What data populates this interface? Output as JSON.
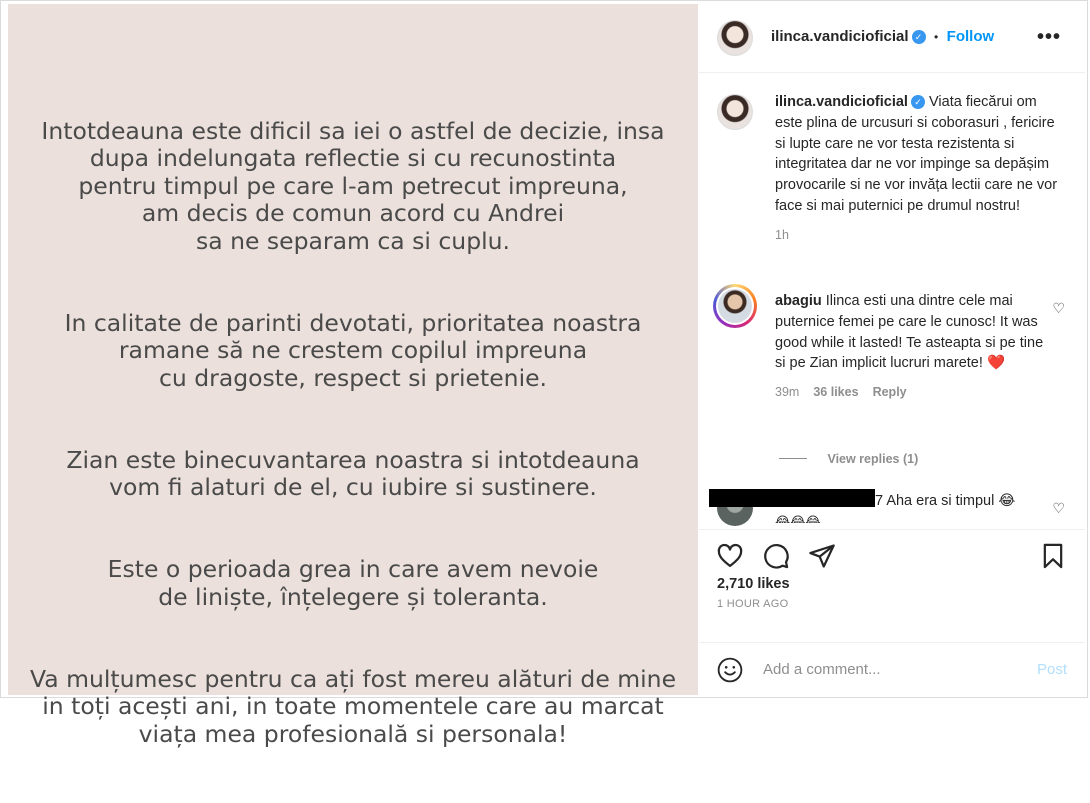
{
  "post": {
    "paragraphs": [
      "Intotdeauna este dificil sa iei o astfel de decizie, insa\ndupa indelungata reflectie si cu recunostinta\npentru timpul pe care l-am petrecut impreuna,\nam decis de comun acord cu Andrei\nsa ne separam ca si cuplu.",
      "In calitate de parinti devotati, prioritatea noastra\nramane să ne crestem copilul impreuna\ncu dragoste, respect si prietenie.",
      "Zian este binecuvantarea noastra si intotdeauna\nvom fi alaturi de el, cu iubire si sustinere.",
      "Este o perioada grea in care avem nevoie\nde liniște, înțelegere și toleranta.",
      "Va mulțumesc pentru ca ați fost mereu alături de mine\nin toți acești ani, in toate momentele care au marcat\nviața mea profesională si personala!"
    ]
  },
  "header": {
    "username": "ilinca.vandicioficial",
    "separator": "•",
    "follow_label": "Follow"
  },
  "caption": {
    "username": "ilinca.vandicioficial",
    "text": "Viata fiecărui om este plina de urcusuri si coborasuri , fericire si lupte care ne vor testa rezistenta si integritatea dar ne vor impinge sa depășim provocarile si ne vor invăța lectii care ne vor face si mai puternici pe drumul nostru!",
    "time": "1h"
  },
  "comments": [
    {
      "username": "abagiu",
      "text": "Ilinca esti una dintre cele mai puternice femei pe care le cunosc! It was good while it lasted! Te asteapta si pe tine si pe Zian implicit lucruri marete!",
      "emoji": "❤️",
      "time": "39m",
      "likes": "36 likes",
      "reply_label": "Reply",
      "view_replies": "View replies (1)"
    },
    {
      "username": "7",
      "text": "Aha era si timpul 😂",
      "emoji_line": "😂😂😂"
    }
  ],
  "stats": {
    "likes": "2,710 likes",
    "time_ago": "1 HOUR AGO"
  },
  "composer": {
    "placeholder": "Add a comment...",
    "post_label": "Post"
  },
  "colors": {
    "image_bg": "#ebe0db",
    "link_blue": "#0095f6",
    "verified_blue": "#3897f0",
    "post_disabled": "#b2dffc"
  }
}
